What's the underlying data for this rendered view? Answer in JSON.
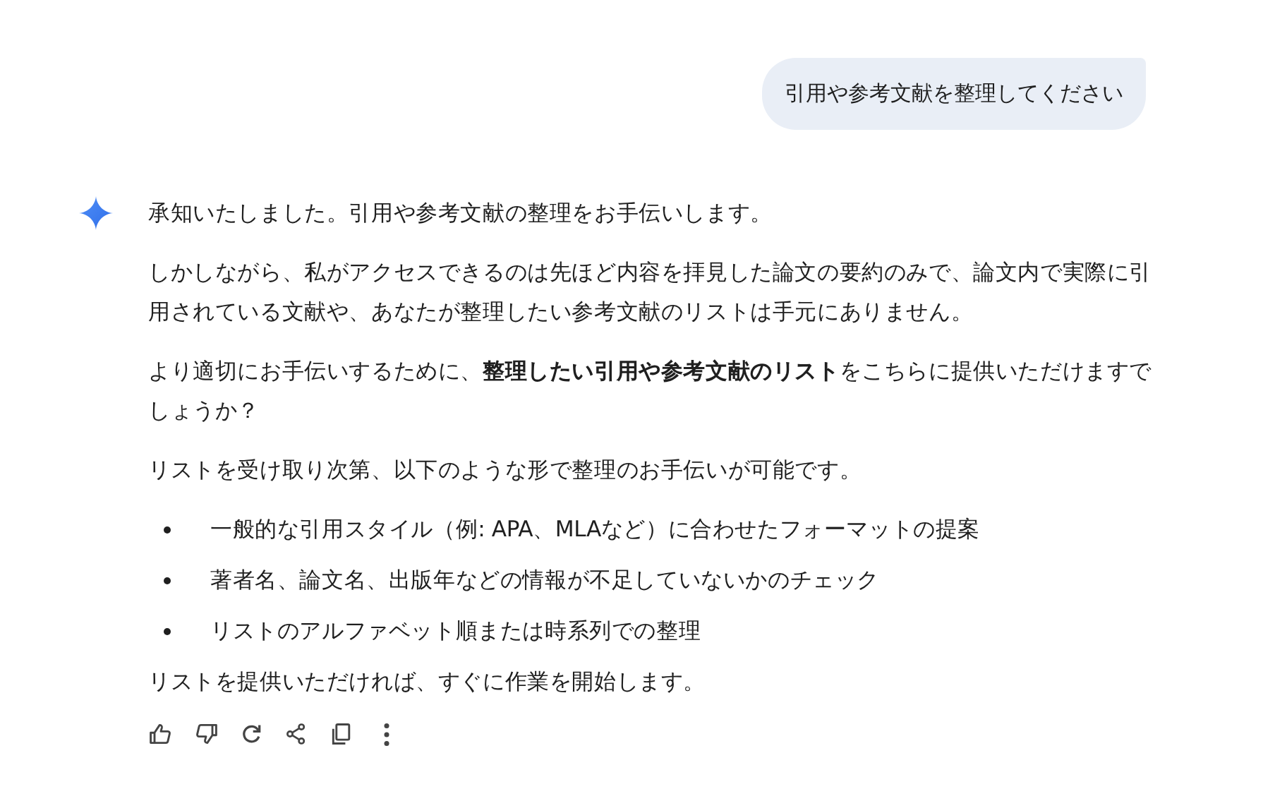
{
  "user_message": "引用や参考文献を整理してください",
  "response": [
    {
      "kind": "paragraph",
      "text": "承知いたしました。引用や参考文献の整理をお手伝いします。"
    },
    {
      "kind": "paragraph",
      "text": "しかしながら、私がアクセスできるのは先ほど内容を拝見した論文の要約のみで、論文内で実際に引用されている文献や、あなたが整理したい参考文献のリストは手元にありません。"
    },
    {
      "kind": "paragraph",
      "text": "より適切にお手伝いするために、**整理したい引用や参考文献のリスト**をこちらに提供いただけますでしょうか？"
    },
    {
      "kind": "paragraph",
      "text": "リストを受け取り次第、以下のような形で整理のお手伝いが可能です。"
    },
    {
      "kind": "list",
      "items": [
        "一般的な引用スタイル（例: APA、MLAなど）に合わせたフォーマットの提案",
        "著者名、論文名、出版年などの情報が不足していないかのチェック",
        "リストのアルファベット順または時系列での整理"
      ]
    },
    {
      "kind": "paragraph",
      "text": "リストを提供いただければ、すぐに作業を開始します。"
    }
  ],
  "actions": [
    {
      "kind": "like"
    },
    {
      "kind": "dislike"
    },
    {
      "kind": "regenerate"
    },
    {
      "kind": "share"
    },
    {
      "kind": "copy"
    },
    {
      "kind": "more"
    }
  ]
}
